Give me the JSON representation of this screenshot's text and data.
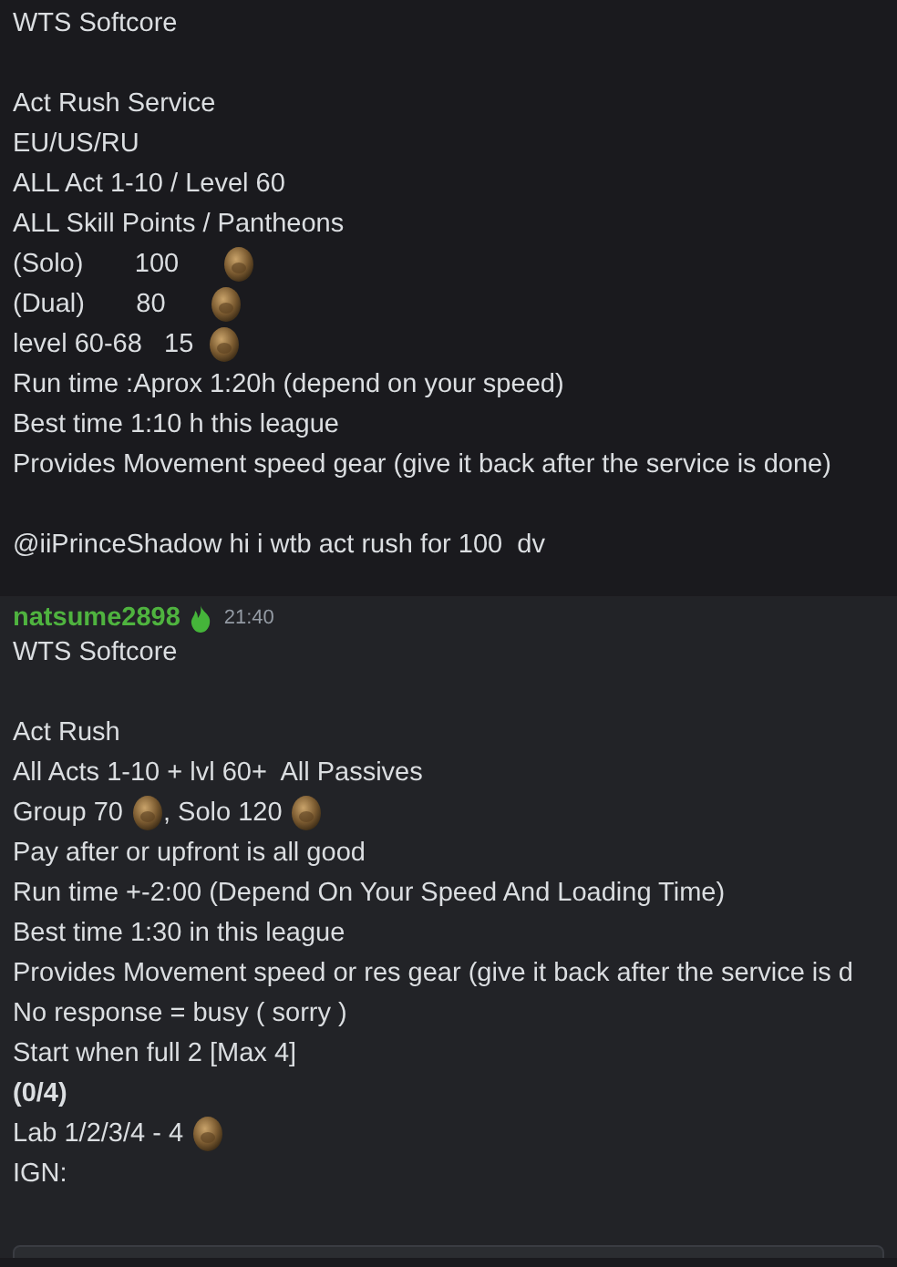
{
  "messages": [
    {
      "selected": false,
      "paragraphs": [
        [
          [
            {
              "kind": "text",
              "text": "WTS Softcore"
            }
          ]
        ],
        [
          [
            {
              "kind": "text",
              "text": "Act Rush Service"
            }
          ],
          [
            {
              "kind": "text",
              "text": "EU/US/RU"
            }
          ],
          [
            {
              "kind": "text",
              "text": "ALL Act 1-10 / Level 60"
            }
          ],
          [
            {
              "kind": "text",
              "text": "ALL Skill Points / Pantheons"
            }
          ],
          [
            {
              "kind": "text",
              "text": "(Solo)       100      "
            },
            {
              "kind": "orb"
            }
          ],
          [
            {
              "kind": "text",
              "text": "(Dual)       80      "
            },
            {
              "kind": "orb"
            }
          ],
          [
            {
              "kind": "text",
              "text": "level 60-68   15  "
            },
            {
              "kind": "orb"
            }
          ],
          [
            {
              "kind": "text",
              "text": "Run time :Aprox 1:20h (depend on your speed)"
            }
          ],
          [
            {
              "kind": "text",
              "text": "Best time 1:10 h this league"
            }
          ],
          [
            {
              "kind": "text",
              "text": "Provides Movement speed gear (give it back after the service is done)"
            }
          ]
        ],
        [
          [
            {
              "kind": "text",
              "text": "@iiPrinceShadow hi i wtb act rush for 100  dv"
            }
          ]
        ]
      ]
    },
    {
      "selected": true,
      "author": "natsume2898",
      "time": "21:40",
      "paragraphs": [
        [
          [
            {
              "kind": "text",
              "text": "WTS Softcore"
            }
          ]
        ],
        [
          [
            {
              "kind": "text",
              "text": "Act Rush"
            }
          ],
          [
            {
              "kind": "text",
              "text": "All Acts 1-10 + lvl 60+  All Passives"
            }
          ],
          [
            {
              "kind": "text",
              "text": "Group 70 "
            },
            {
              "kind": "orb"
            },
            {
              "kind": "text",
              "text": ", Solo 120 "
            },
            {
              "kind": "orb"
            }
          ],
          [
            {
              "kind": "text",
              "text": "Pay after or upfront is all good"
            }
          ],
          [
            {
              "kind": "text",
              "text": "Run time +-2:00 (Depend On Your Speed And Loading Time)"
            }
          ],
          [
            {
              "kind": "text",
              "text": "Best time 1:30 in this league"
            }
          ],
          [
            {
              "kind": "text",
              "text": "Provides Movement speed or res gear (give it back after the service is d"
            }
          ],
          [
            {
              "kind": "text",
              "text": "No response = busy ( sorry )"
            }
          ],
          [
            {
              "kind": "text",
              "text": "Start when full 2 [Max 4]"
            }
          ],
          [
            {
              "kind": "bold",
              "text": "(0/4)"
            }
          ],
          [
            {
              "kind": "text",
              "text": "Lab 1/2/3/4 - 4 "
            },
            {
              "kind": "orb"
            }
          ],
          [
            {
              "kind": "text",
              "text": "IGN:"
            }
          ]
        ]
      ],
      "code_block": true
    }
  ]
}
